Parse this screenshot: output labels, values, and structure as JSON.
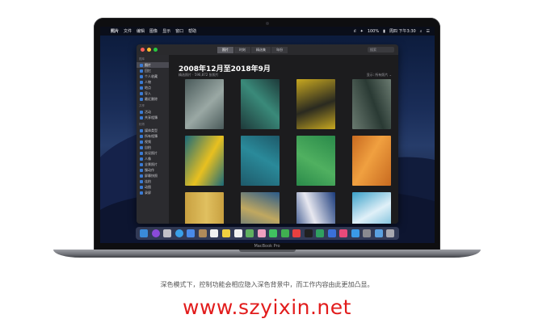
{
  "menubar": {
    "app": "照片",
    "items": [
      "文件",
      "编辑",
      "图像",
      "显示",
      "窗口",
      "帮助"
    ],
    "right": [
      "ıl",
      "✦",
      "100%",
      "▮",
      "周四 下午3:30",
      "⌕",
      "☰"
    ]
  },
  "window": {
    "tabs": [
      "照片",
      "时刻",
      "精选集",
      "年份"
    ],
    "active_tab": 0,
    "search_placeholder": "搜索",
    "sidebar": {
      "sections": [
        {
          "heading": "图库",
          "items": [
            "照片",
            "回忆",
            "个人收藏",
            "人物",
            "地点",
            "导入",
            "最近删除"
          ]
        },
        {
          "heading": "共享",
          "items": [
            "活动",
            "共享相簿"
          ]
        },
        {
          "heading": "相簿",
          "items": [
            "媒体类型",
            "所有相簿",
            "视频",
            "自拍",
            "实况照片",
            "人像",
            "全景照片",
            "慢动作",
            "屏幕快照",
            "连拍",
            "动图",
            "录屏"
          ]
        }
      ],
      "selected": "照片"
    },
    "title": "2008年12月至2018年9月",
    "subtitle": "精选照片 · 596,872 张照片",
    "right_controls": "显示: 所有照片 ⌄",
    "photos": [
      {
        "name": "photo-1",
        "c1": "#4a5a5a",
        "c2": "#9aa8a4"
      },
      {
        "name": "photo-2",
        "c1": "#1e3a3a",
        "c2": "#3a8a7a"
      },
      {
        "name": "photo-3",
        "c1": "#c8a820",
        "c2": "#2a2a20"
      },
      {
        "name": "photo-4",
        "c1": "#6a7a70",
        "c2": "#2a3a34"
      },
      {
        "name": "photo-5",
        "c1": "#1a6a7a",
        "c2": "#e8c020"
      },
      {
        "name": "photo-6",
        "c1": "#1e5a6a",
        "c2": "#2a8a9a"
      },
      {
        "name": "photo-7",
        "c1": "#2a8a4a",
        "c2": "#50b060"
      },
      {
        "name": "photo-8",
        "c1": "#c86a20",
        "c2": "#f0a040"
      },
      {
        "name": "photo-9",
        "c1": "#c8a040",
        "c2": "#e0c060"
      },
      {
        "name": "photo-10",
        "c1": "#2a5a8a",
        "c2": "#c0a860"
      },
      {
        "name": "photo-11",
        "c1": "#1a3a7a",
        "c2": "#e8e8f0"
      },
      {
        "name": "photo-12",
        "c1": "#3aa0c8",
        "c2": "#e0f0f8"
      }
    ]
  },
  "dock": {
    "icons": [
      {
        "name": "finder-icon",
        "color": "#3a8ad8"
      },
      {
        "name": "siri-icon",
        "color": "#8a4ad8"
      },
      {
        "name": "launchpad-icon",
        "color": "#c0c0c8"
      },
      {
        "name": "safari-icon",
        "color": "#3aa0e8"
      },
      {
        "name": "mail-icon",
        "color": "#4a8ae8"
      },
      {
        "name": "contacts-icon",
        "color": "#b08a5a"
      },
      {
        "name": "calendar-icon",
        "color": "#f0f0f0"
      },
      {
        "name": "notes-icon",
        "color": "#f0d040"
      },
      {
        "name": "reminders-icon",
        "color": "#f0f0f0"
      },
      {
        "name": "maps-icon",
        "color": "#60b060"
      },
      {
        "name": "photos-icon",
        "color": "#f0a0c0"
      },
      {
        "name": "messages-icon",
        "color": "#40c060"
      },
      {
        "name": "facetime-icon",
        "color": "#40b050"
      },
      {
        "name": "news-icon",
        "color": "#e84040"
      },
      {
        "name": "stocks-icon",
        "color": "#202020"
      },
      {
        "name": "numbers-icon",
        "color": "#30a060"
      },
      {
        "name": "keynote-icon",
        "color": "#3a70d8"
      },
      {
        "name": "music-icon",
        "color": "#e84a7a"
      },
      {
        "name": "appstore-icon",
        "color": "#3a9ae8"
      },
      {
        "name": "preferences-icon",
        "color": "#8a8a90"
      },
      {
        "name": "folder-icon",
        "color": "#5aa0e0"
      },
      {
        "name": "trash-icon",
        "color": "#a8a8b0"
      }
    ]
  },
  "device_label": "MacBook Pro",
  "caption": "深色模式下，控制功能会相应隐入深色背景中，而工作内容由此更加凸显。",
  "watermark": "www.szyixin.net"
}
